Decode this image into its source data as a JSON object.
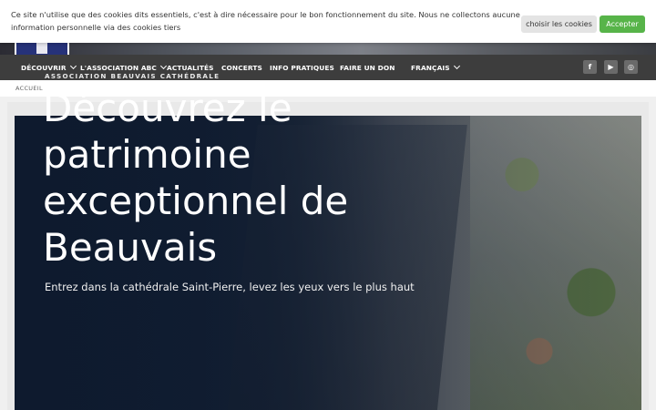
{
  "cookie": {
    "message": "Ce site n'utilise que des cookies dits essentiels, c'est à dire nécessaire pour le bon fonctionnement du site. Nous ne collectons aucune information personnelle via des cookies tiers",
    "choose_label": "choisir les cookies",
    "accept_label": "Accepter",
    "accept_color": "#57b449"
  },
  "nav": {
    "items": [
      {
        "label": "DÉCOUVRIR",
        "dropdown": true
      },
      {
        "label": "L'ASSOCIATION ABC",
        "dropdown": true
      },
      {
        "label": "ACTUALITÉS",
        "dropdown": false
      },
      {
        "label": "CONCERTS",
        "dropdown": false
      },
      {
        "label": "INFO PRATIQUES",
        "dropdown": false
      },
      {
        "label": "FAIRE UN DON",
        "dropdown": false
      },
      {
        "label": "FRANÇAIS",
        "dropdown": true
      }
    ],
    "social": [
      {
        "icon": "facebook-icon",
        "glyph": "f"
      },
      {
        "icon": "youtube-icon",
        "glyph": "▶"
      },
      {
        "icon": "instagram-icon",
        "glyph": "◎"
      }
    ]
  },
  "breadcrumb": {
    "home": "ACCUEIL"
  },
  "hero": {
    "kicker": "ASSOCIATION BEAUVAIS CATHÉDRALE",
    "title": "Découvrez le patrimoine exceptionnel de Beauvais",
    "subtitle": "Entrez dans la cathédrale Saint-Pierre, levez les yeux vers le plus haut"
  }
}
